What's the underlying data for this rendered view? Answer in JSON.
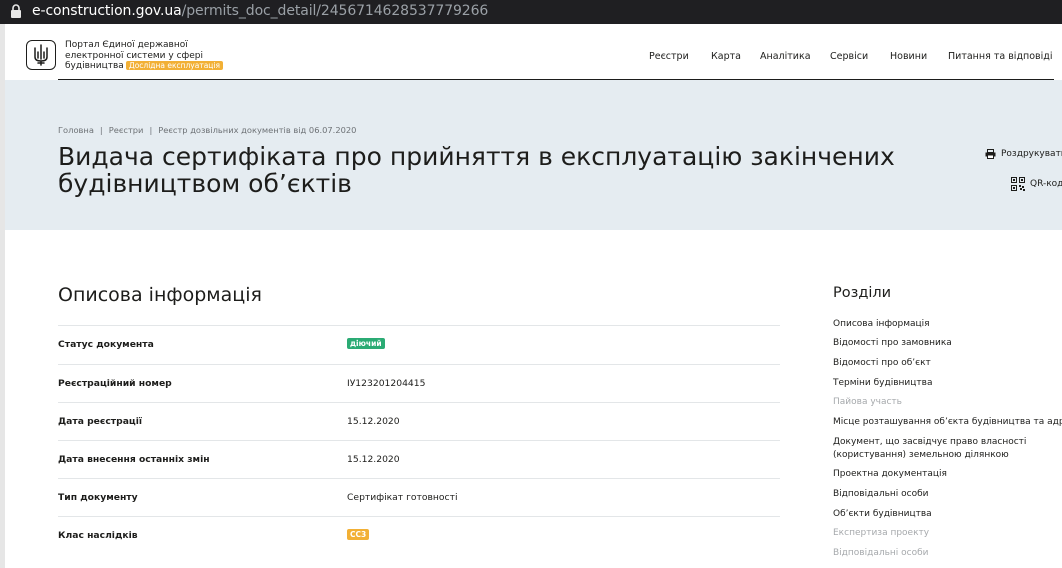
{
  "browser": {
    "url_domain": "e-construction.gov.ua",
    "url_path": "/permits_doc_detail/2456714628537779266"
  },
  "header": {
    "portal_name": "Портал Єдиної державної електронної системи у сфері будівництва",
    "beta_badge": "Дослідна експлуатація",
    "nav": [
      "Реєстри",
      "Карта",
      "Аналітика",
      "Сервіси",
      "Новини",
      "Питання та відповіді"
    ]
  },
  "breadcrumb": [
    "Головна",
    "Реєстри",
    "Реєстр дозвільних документів від 06.07.2020"
  ],
  "page_title": "Видача сертифіката про прийняття в експлуатацію закінчених будівництвом об’єктів",
  "actions": {
    "print": "Роздрукувати",
    "qr": "QR-код"
  },
  "main": {
    "section_title": "Описова інформація",
    "rows": [
      {
        "label": "Статус документа",
        "value": "діючий"
      },
      {
        "label": "Реєстраційний номер",
        "value": "IУ123201204415"
      },
      {
        "label": "Дата реєстрації",
        "value": "15.12.2020"
      },
      {
        "label": "Дата внесення останніх змін",
        "value": "15.12.2020"
      },
      {
        "label": "Тип документу",
        "value": "Сертифікат готовності"
      },
      {
        "label": "Клас наслідків",
        "value": "СС3"
      }
    ]
  },
  "sections": {
    "title": "Розділи",
    "items": [
      {
        "label": "Описова інформація",
        "disabled": false
      },
      {
        "label": "Відомості про замовника",
        "disabled": false
      },
      {
        "label": "Відомості про об’єкт",
        "disabled": false
      },
      {
        "label": "Терміни будівництва",
        "disabled": false
      },
      {
        "label": "Пайова участь",
        "disabled": true
      },
      {
        "label": "Місце розташування об’єкта будівництва та адреса",
        "disabled": false
      },
      {
        "label": "Документ, що засвідчує право власності",
        "label2": "(користування) земельною ділянкою",
        "disabled": false
      },
      {
        "label": "Проектна документація",
        "disabled": false
      },
      {
        "label": "Відповідальні особи",
        "disabled": false
      },
      {
        "label": "Об’єкти будівництва",
        "disabled": false
      },
      {
        "label": "Експертиза проекту",
        "disabled": true
      },
      {
        "label": "Відповідальні особи",
        "disabled": true
      }
    ]
  },
  "colors": {
    "accent_green": "#2bab74",
    "accent_orange": "#f2b035",
    "hero_bg": "#e5ecf1"
  }
}
